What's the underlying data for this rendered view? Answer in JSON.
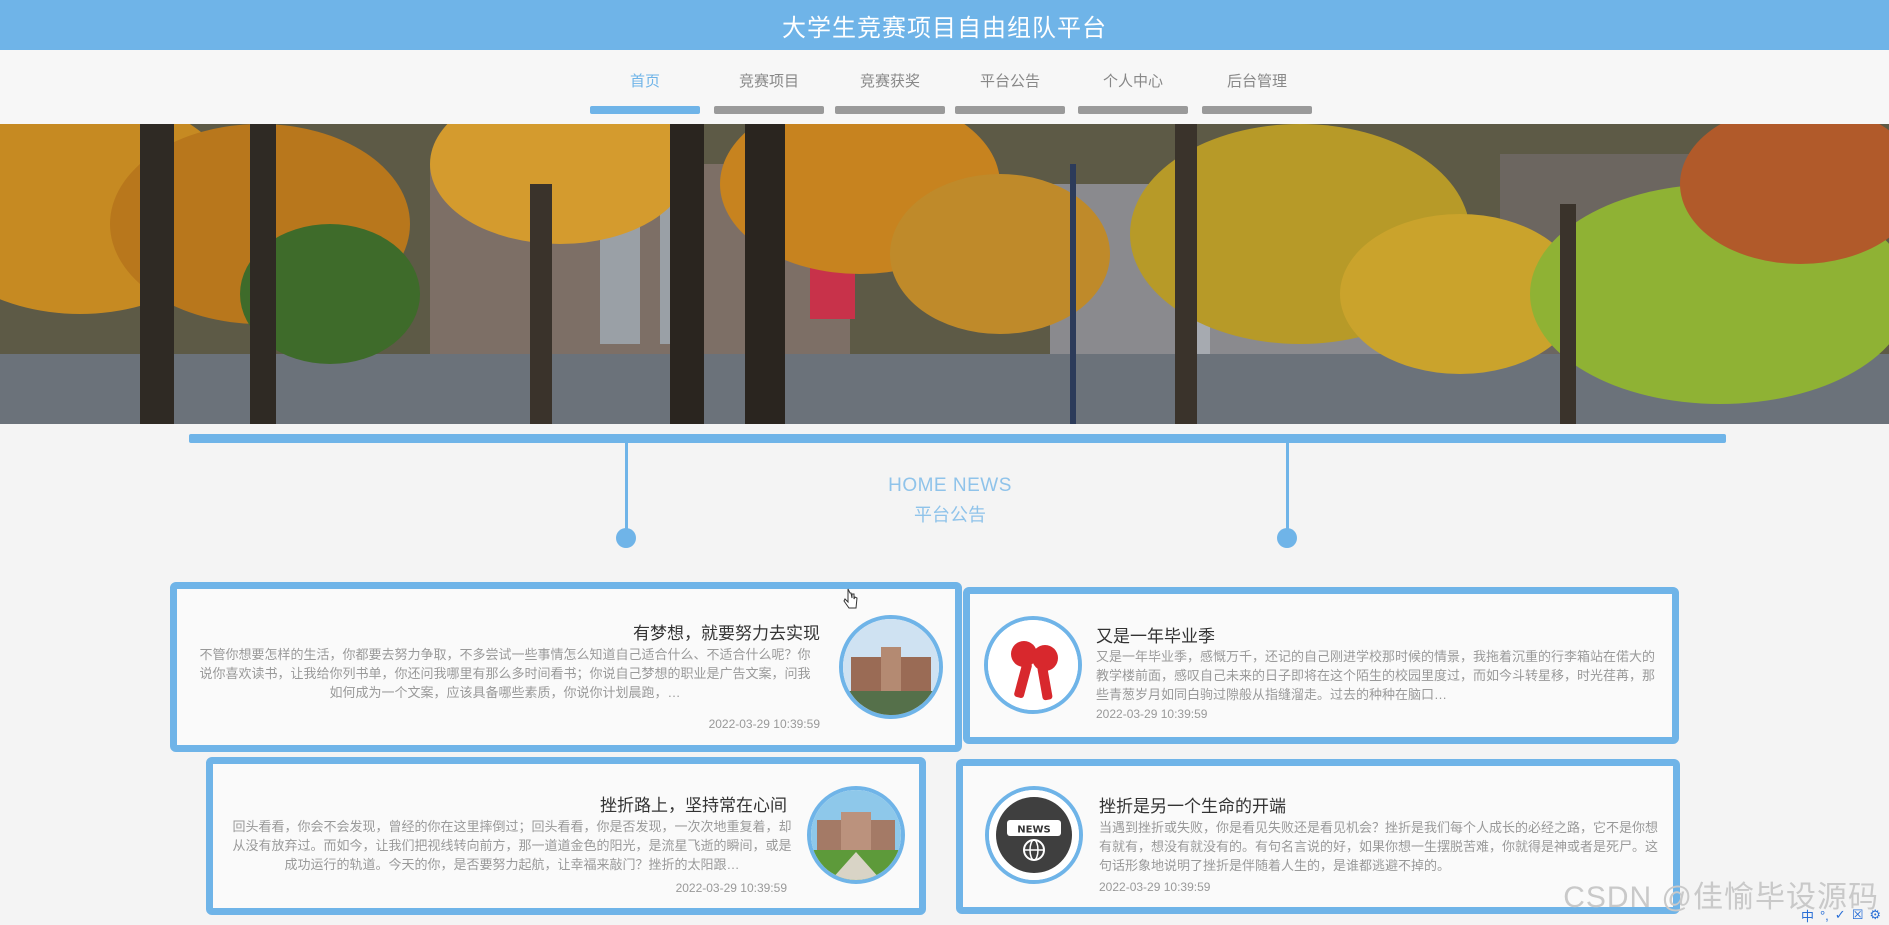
{
  "header": {
    "title": "大学生竞赛项目自由组队平台"
  },
  "nav": {
    "items": [
      {
        "label": "首页",
        "active": true
      },
      {
        "label": "竞赛项目",
        "active": false
      },
      {
        "label": "竞赛获奖",
        "active": false
      },
      {
        "label": "平台公告",
        "active": false
      },
      {
        "label": "个人中心",
        "active": false
      },
      {
        "label": "后台管理",
        "active": false
      }
    ]
  },
  "section": {
    "title_en": "HOME NEWS",
    "title_cn": "平台公告"
  },
  "news": [
    {
      "title": "有梦想，就要努力去实现",
      "body": "不管你想要怎样的生活，你都要去努力争取，不多尝试一些事情怎么知道自己适合什么、不适合什么呢？你说你喜欢读书，让我给你列书单，你还问我哪里有那么多时间看书；你说自己梦想的职业是广告文案，问我如何成为一个文案，应该具备哪些素质，你说你计划晨跑，…",
      "date": "2022-03-29 10:39:59",
      "icon": "campus-building-icon"
    },
    {
      "title": "又是一年毕业季",
      "body": "又是一年毕业季，感慨万千，还记的自己刚进学校那时候的情景，我拖着沉重的行李箱站在偌大的教学楼前面，感叹自己未来的日子即将在这个陌生的校园里度过，而如今斗转星移，时光荏苒，那些青葱岁月如同白驹过隙般从指缝溜走。过去的种种在脑口…",
      "date": "2022-03-29 10:39:59",
      "icon": "microphone-icon"
    },
    {
      "title": "挫折路上，坚持常在心间",
      "body": "回头看看，你会不会发现，曾经的你在这里摔倒过；回头看看，你是否发现，一次次地重复着，却从没有放弃过。而如今，让我们把视线转向前方，那一道道金色的阳光，是流星飞逝的瞬间，或是成功运行的轨道。今天的你，是否要努力起航，让幸福来敲门？挫折的太阳跟…",
      "date": "2022-03-29 10:39:59",
      "icon": "campus-lawn-icon"
    },
    {
      "title": "挫折是另一个生命的开端",
      "body": "当遇到挫折或失败，你是看见失败还是看见机会？挫折是我们每个人成长的必经之路，它不是你想有就有，想没有就没有的。有句名言说的好，如果你想一生摆脱苦难，你就得是神或者是死尸。这句话形象地说明了挫折是伴随着人生的，是谁都逃避不掉的。",
      "date": "2022-03-29 10:39:59",
      "icon": "news-globe-icon"
    }
  ],
  "watermark": "CSDN @佳愉毕设源码",
  "tray": [
    "中",
    "°,",
    "✓",
    "☒",
    "⚙"
  ]
}
